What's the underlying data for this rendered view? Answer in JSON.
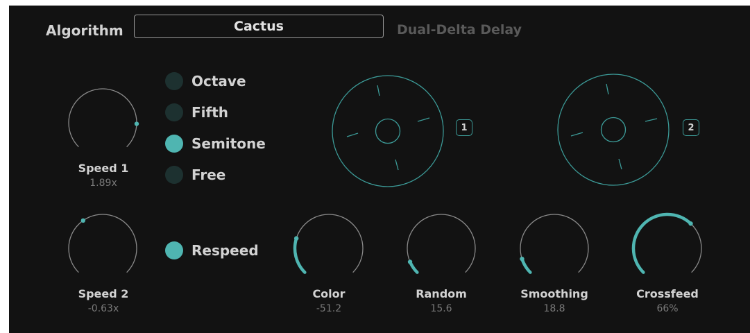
{
  "header": {
    "algorithm_label": "Algorithm",
    "algorithm_value": "Cactus",
    "algorithm_description": "Dual-Delta Delay"
  },
  "knobs": {
    "speed1": {
      "label": "Speed 1",
      "value": "1.89x",
      "level": 0.84,
      "fill": false
    },
    "speed2": {
      "label": "Speed 2",
      "value": "-0.63x",
      "level": 0.37,
      "fill": false
    },
    "color": {
      "label": "Color",
      "value": "-51.2",
      "level": 0.23,
      "fill": true
    },
    "random": {
      "label": "Random",
      "value": "15.6",
      "level": 0.08,
      "fill": true
    },
    "smoothing": {
      "label": "Smoothing",
      "value": "18.8",
      "level": 0.1,
      "fill": true
    },
    "crossfeed": {
      "label": "Crossfeed",
      "value": "66%",
      "level": 0.66,
      "fill": true
    }
  },
  "interval_options": [
    {
      "label": "Octave",
      "selected": false
    },
    {
      "label": "Fifth",
      "selected": false
    },
    {
      "label": "Semitone",
      "selected": true
    },
    {
      "label": "Free",
      "selected": false
    }
  ],
  "respeed": {
    "label": "Respeed",
    "on": true
  },
  "pads": [
    {
      "badge": "1"
    },
    {
      "badge": "2"
    }
  ],
  "colors": {
    "background": "#121212",
    "accent": "#4fb5b1",
    "accent_dim": "#1d3130",
    "outline": "#3c9b98",
    "track": "#8a8a8a",
    "text": "#d2d2d2",
    "subtext": "#7a7a7a"
  }
}
